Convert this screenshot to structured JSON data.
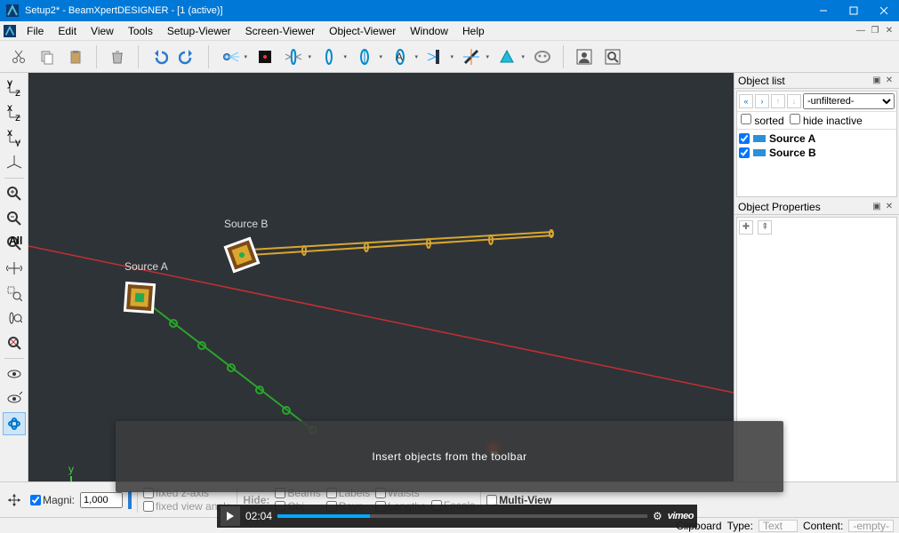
{
  "window": {
    "title": "Setup2* - BeamXpertDESIGNER - [1 (active)]"
  },
  "menu": {
    "items": [
      "File",
      "Edit",
      "View",
      "Tools",
      "Setup-Viewer",
      "Screen-Viewer",
      "Object-Viewer",
      "Window",
      "Help"
    ]
  },
  "toolbar": {
    "cut": "cut",
    "copy": "copy",
    "paste": "paste",
    "delete": "delete",
    "undo": "undo",
    "redo": "redo"
  },
  "scene": {
    "source_a_label": "Source A",
    "source_b_label": "Source B",
    "axis_x": "x",
    "axis_y": "y",
    "axis_z": "z"
  },
  "objectlist": {
    "title": "Object list",
    "filter": "-unfiltered-",
    "sorted_label": "sorted",
    "hide_inactive_label": "hide inactive",
    "items": [
      {
        "label": "Source A",
        "color": "#2aa52a",
        "checked": true
      },
      {
        "label": "Source B",
        "color": "#d9a62e",
        "checked": true
      }
    ]
  },
  "properties": {
    "title": "Object Properties"
  },
  "bottom": {
    "magni_label": "Magni:",
    "magni_value": "1,000",
    "fixed_z_label": "fixed z-axis",
    "fixed_angle_label": "fixed view angle",
    "hide_label": "Hide:",
    "beams_label": "Beams",
    "labels_label": "Labels",
    "waists_label": "Waists",
    "obj_label": "Obj.",
    "rays_label": "Rays",
    "lengths_label": "Lengths",
    "focals_label": "Focals",
    "multiview_label": "Multi-View"
  },
  "status": {
    "clipboard_label": "Clipboard",
    "type_label": "Type:",
    "type_value": "Text",
    "content_label": "Content:",
    "content_value": "-empty-"
  },
  "overlay": {
    "text": "Insert objects from the toolbar"
  },
  "video": {
    "time": "02:04",
    "brand": "vimeo"
  }
}
